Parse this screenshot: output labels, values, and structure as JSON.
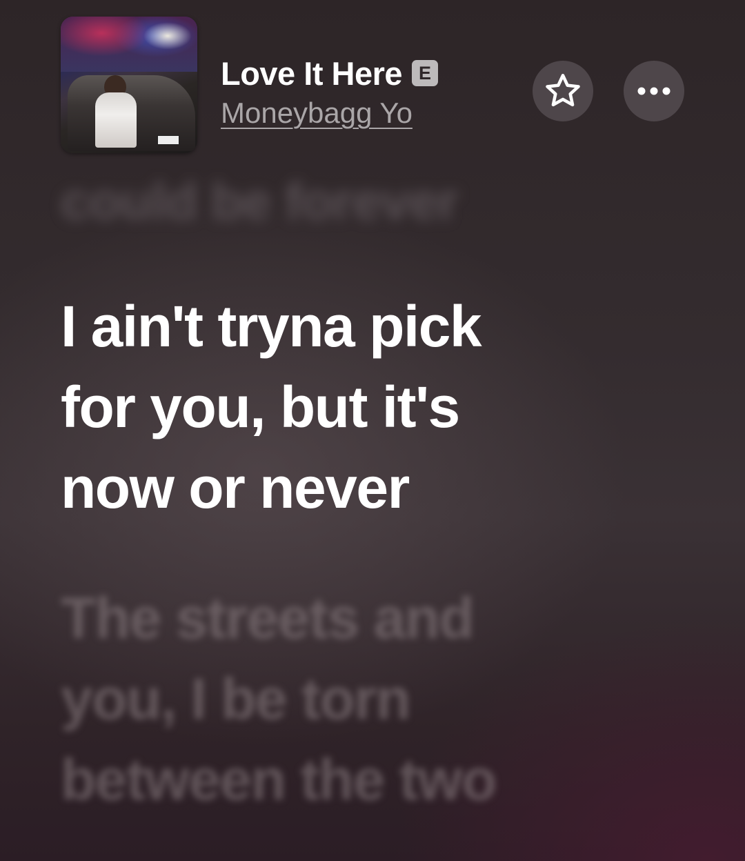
{
  "now_playing": {
    "title": "Love It Here",
    "explicit_badge": "E",
    "artist": "Moneybagg Yo"
  },
  "actions": {
    "favorite_icon": "star-icon",
    "more_icon": "ellipsis-icon"
  },
  "lyrics": {
    "previous_line": "could be forever",
    "current_lines": [
      "I ain't tryna pick",
      "for you, but it's",
      "now or never"
    ],
    "next_lines": [
      "The streets and",
      "you, I be torn",
      "between the two"
    ]
  }
}
